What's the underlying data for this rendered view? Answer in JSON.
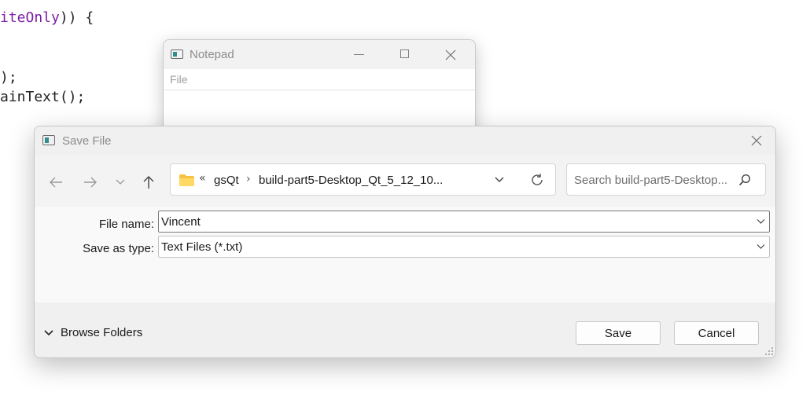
{
  "background_code": {
    "line1": {
      "kw": "iteOnly",
      "rest": ")) {"
    },
    "line2": ");",
    "line3": "ainText();"
  },
  "notepad": {
    "title": "Notepad",
    "menu_file": "File",
    "icons": [
      "app-icon",
      "minimize-icon",
      "maximize-icon",
      "close-icon"
    ]
  },
  "dialog": {
    "title": "Save File",
    "nav": {
      "back_icon": "arrow-left-icon",
      "forward_icon": "arrow-right-icon",
      "recent_icon": "chevron-down-icon",
      "up_icon": "arrow-up-icon"
    },
    "address": {
      "overflow": "«",
      "segment1": "gsQt",
      "separator": "›",
      "segment2": "build-part5-Desktop_Qt_5_12_10..."
    },
    "search": {
      "placeholder": "Search build-part5-Desktop..."
    },
    "file_name_label": "File name:",
    "file_name_value": "Vincent",
    "save_type_label": "Save as type:",
    "save_type_value": "Text Files (*.txt)",
    "browse_folders": "Browse Folders",
    "save_button": "Save",
    "cancel_button": "Cancel"
  },
  "colors": {
    "code_keyword": "#7b1fa2",
    "folder": "#f5c342",
    "titlebar": "#f0f0f0"
  }
}
